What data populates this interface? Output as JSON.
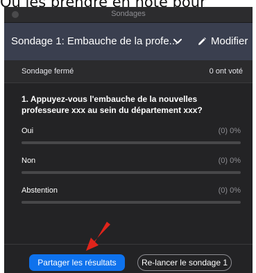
{
  "caption": "Ou les prendre en note pour",
  "window": {
    "title": "Sondages"
  },
  "header": {
    "poll_title": "Sondage 1: Embauche de la profe...",
    "edit_label": "Modifier"
  },
  "status": {
    "state": "Sondage fermé",
    "votes": "0 ont voté"
  },
  "question": "1. Appuyez-vous l'embauche de la nouvelles professeure xxx au sein du département xxx?",
  "options": [
    {
      "label": "Oui",
      "result": "(0) 0%",
      "fraction": 0
    },
    {
      "label": "Non",
      "result": "(0) 0%",
      "fraction": 0
    },
    {
      "label": "Abstention",
      "result": "(0) 0%",
      "fraction": 0
    }
  ],
  "footer": {
    "share_label": "Partager les résultats",
    "relaunch_label": "Re-lancer le sondage 1"
  },
  "colors": {
    "accent": "#0e72ed",
    "arrow": "#e0241b",
    "header_bg": "#3a3f4f"
  }
}
